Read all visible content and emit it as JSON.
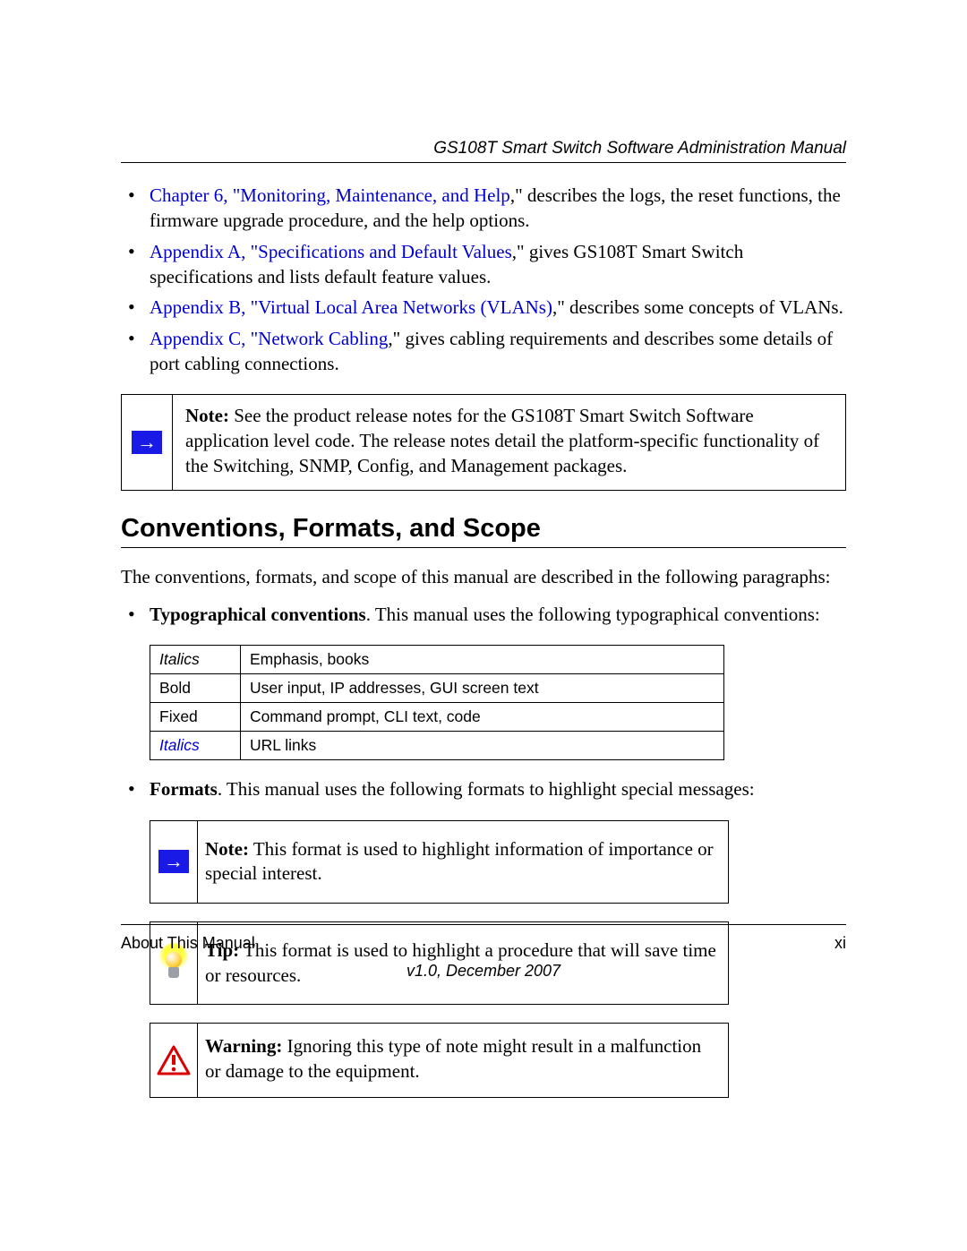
{
  "header": {
    "running_title": "GS108T Smart Switch Software Administration Manual"
  },
  "bullets_top": [
    {
      "xref": "Chapter 6, \"Monitoring, Maintenance, and Help",
      "tail": ",\" describes the logs, the reset functions, the firmware upgrade procedure, and the help options."
    },
    {
      "xref": "Appendix A, \"Specifications and Default Values",
      "tail": ",\" gives GS108T Smart Switch specifications and lists default feature values."
    },
    {
      "xref": "Appendix B, \"Virtual Local Area Networks (VLANs)",
      "tail": ",\" describes some concepts of VLANs."
    },
    {
      "xref": "Appendix C, \"Network Cabling",
      "tail": ",\" gives cabling requirements and describes some details of port cabling connections."
    }
  ],
  "top_note": {
    "label": "Note:",
    "text": " See the product release notes for the GS108T Smart Switch Software application level code. The release notes detail the platform-specific functionality of the Switching, SNMP, Config, and Management packages."
  },
  "section_heading": "Conventions, Formats, and Scope",
  "intro_para": "The conventions, formats, and scope of this manual are described in the following paragraphs:",
  "conv_bullet": {
    "label": "Typographical conventions",
    "tail": ". This manual uses the following typographical conventions:"
  },
  "conv_table": [
    {
      "style": "ital",
      "name": "Italics",
      "desc": "Emphasis, books"
    },
    {
      "style": "plain",
      "name": "Bold",
      "desc": "User input, IP addresses, GUI screen text"
    },
    {
      "style": "plain",
      "name": "Fixed",
      "desc": "Command prompt, CLI text, code"
    },
    {
      "style": "xref-ital",
      "name": "Italics",
      "desc": "URL links"
    }
  ],
  "formats_bullet": {
    "label": "Formats",
    "tail": ". This manual uses the following formats to highlight special messages:"
  },
  "format_boxes": {
    "note": {
      "label": "Note:",
      "text": " This format is used to highlight information of importance or special interest."
    },
    "tip": {
      "label": "Tip:",
      "text": " This format is used to highlight a procedure that will save time or resources."
    },
    "warning": {
      "label": "Warning:",
      "text": " Ignoring this type of note might result in a malfunction or damage to the equipment."
    }
  },
  "footer": {
    "section": "About This Manual",
    "page": "xi",
    "version": "v1.0, December 2007"
  }
}
